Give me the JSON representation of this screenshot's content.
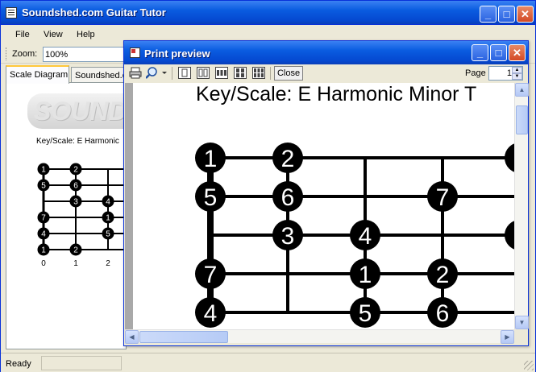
{
  "app": {
    "title": "Soundshed.com Guitar Tutor",
    "window_buttons": {
      "minimize": "_",
      "maximize": "□",
      "close": "✕"
    }
  },
  "menu": {
    "items": [
      "File",
      "View",
      "Help"
    ]
  },
  "toolbar": {
    "zoom_label": "Zoom:",
    "zoom_value": "100%"
  },
  "tabs": [
    "Scale Diagram",
    "Soundshed.c"
  ],
  "scale_panel": {
    "logo_text": "SOUNDSHED",
    "key_label": "Key/Scale: E Harmonic",
    "fret_numbers": [
      "0",
      "1",
      "2"
    ],
    "notes": [
      {
        "string": 0,
        "fret": 0,
        "label": "1"
      },
      {
        "string": 0,
        "fret": 1,
        "label": "2"
      },
      {
        "string": 1,
        "fret": 0,
        "label": "5"
      },
      {
        "string": 1,
        "fret": 1,
        "label": "6"
      },
      {
        "string": 2,
        "fret": 1,
        "label": "3"
      },
      {
        "string": 2,
        "fret": 2,
        "label": "4"
      },
      {
        "string": 3,
        "fret": 0,
        "label": "7"
      },
      {
        "string": 3,
        "fret": 2,
        "label": "1"
      },
      {
        "string": 4,
        "fret": 0,
        "label": "4"
      },
      {
        "string": 4,
        "fret": 2,
        "label": "5"
      },
      {
        "string": 5,
        "fret": 0,
        "label": "1"
      },
      {
        "string": 5,
        "fret": 1,
        "label": "2"
      }
    ]
  },
  "status": {
    "text": "Ready"
  },
  "print_preview": {
    "title": "Print preview",
    "close_label": "Close",
    "page_label": "Page",
    "page_value": "1",
    "heading": "Key/Scale: E Harmonic Minor  T",
    "notes": [
      {
        "string": 0,
        "fret": 0,
        "label": "1"
      },
      {
        "string": 0,
        "fret": 1,
        "label": "2"
      },
      {
        "string": 0,
        "fret": 4,
        "label": ""
      },
      {
        "string": 1,
        "fret": 0,
        "label": "5"
      },
      {
        "string": 1,
        "fret": 1,
        "label": "6"
      },
      {
        "string": 1,
        "fret": 3,
        "label": "7"
      },
      {
        "string": 2,
        "fret": 1,
        "label": "3"
      },
      {
        "string": 2,
        "fret": 2,
        "label": "4"
      },
      {
        "string": 2,
        "fret": 4,
        "label": ""
      },
      {
        "string": 3,
        "fret": 0,
        "label": "7"
      },
      {
        "string": 3,
        "fret": 2,
        "label": "1"
      },
      {
        "string": 3,
        "fret": 3,
        "label": "2"
      },
      {
        "string": 4,
        "fret": 0,
        "label": "4"
      },
      {
        "string": 4,
        "fret": 2,
        "label": "5"
      },
      {
        "string": 4,
        "fret": 3,
        "label": "6"
      }
    ]
  }
}
